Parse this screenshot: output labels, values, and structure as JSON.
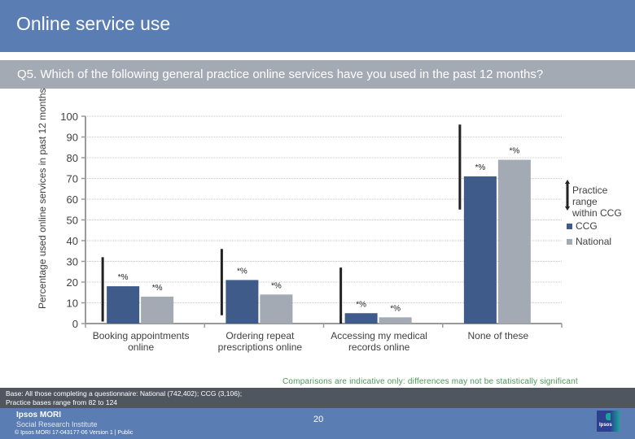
{
  "header": {
    "title": "Online service use"
  },
  "question": "Q5. Which of the following general practice online services have you used in the past 12 months?",
  "chart_data": {
    "type": "bar",
    "title": "",
    "xlabel": "",
    "ylabel": "Percentage used online services in past 12 months",
    "ylim": [
      0,
      100
    ],
    "yticks": [
      0,
      10,
      20,
      30,
      40,
      50,
      60,
      70,
      80,
      90,
      100
    ],
    "grid": true,
    "categories": [
      "Booking appointments online",
      "Ordering repeat prescriptions online",
      "Accessing my medical records online",
      "None of these"
    ],
    "category_lines": [
      [
        "Booking appointments",
        "online"
      ],
      [
        "Ordering repeat",
        "prescriptions online"
      ],
      [
        "Accessing my medical",
        "records online"
      ],
      [
        "None of these"
      ]
    ],
    "series": [
      {
        "name": "CCG",
        "color": "#3f5b8a",
        "values": [
          18,
          21,
          5,
          71
        ],
        "labels": [
          "*%",
          "*%",
          "*%",
          "*%"
        ]
      },
      {
        "name": "National",
        "color": "#a3aab3",
        "values": [
          13,
          14,
          3,
          79
        ],
        "labels": [
          "*%",
          "*%",
          "*%",
          "*%"
        ]
      }
    ],
    "practice_range": {
      "name": "Practice range within CCG",
      "color": "#222222",
      "min": [
        1,
        4,
        0,
        55
      ],
      "max": [
        32,
        36,
        27,
        96
      ]
    },
    "legend": {
      "placement": "right",
      "range_label_lines": [
        "Practice range",
        "within CCG"
      ],
      "items": [
        "CCG",
        "National"
      ]
    }
  },
  "note": "Comparisons are indicative only: differences may not be statistically significant",
  "base": {
    "line1": "Base: All those completing a questionnaire: National (742,402); CCG (3,106);",
    "line2": "Practice bases range from 82 to 124"
  },
  "footer": {
    "brand_name": "Ipsos MORI",
    "brand_sub": "Social Research Institute",
    "copyright": "© Ipsos MORI     17-043177-06 Version 1 | Public",
    "page_number": "20",
    "logo_text": "Ipsos"
  }
}
